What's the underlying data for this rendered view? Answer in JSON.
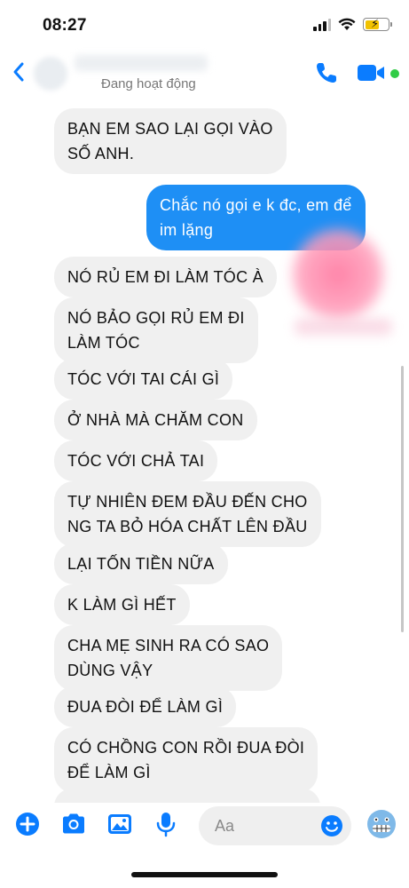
{
  "status_bar": {
    "time": "08:27"
  },
  "header": {
    "active_status": "Đang hoạt động",
    "icons": [
      "back-icon",
      "phone-icon",
      "video-icon"
    ]
  },
  "messages": [
    {
      "side": "incoming",
      "text": "BẠN EM SAO LẠI GỌI VÀO\nSỐ ANH."
    },
    {
      "side": "outgoing",
      "text": "Chắc nó gọi e k đc, em để\nim lặng"
    },
    {
      "side": "incoming",
      "text": "NÓ RỦ EM ĐI LÀM TÓC À"
    },
    {
      "side": "incoming",
      "text": "NÓ BẢO GỌI RỦ EM ĐI\nLÀM TÓC"
    },
    {
      "side": "incoming",
      "text": "TÓC VỚI TAI CÁI GÌ"
    },
    {
      "side": "incoming",
      "text": "Ở NHÀ MÀ CHĂM CON"
    },
    {
      "side": "incoming",
      "text": "TÓC VỚI CHẢ TAI"
    },
    {
      "side": "incoming",
      "text": "TỰ NHIÊN ĐEM ĐẦU ĐẾN CHO\nNG TA BỎ HÓA CHẤT LÊN ĐẦU"
    },
    {
      "side": "incoming",
      "text": "LẠI TỐN TIỀN NỮA"
    },
    {
      "side": "incoming",
      "text": "K LÀM GÌ HẾT"
    },
    {
      "side": "incoming",
      "text": "CHA MẸ SINH RA CÓ SAO\nDÙNG VẬY"
    },
    {
      "side": "incoming",
      "text": "ĐUA ĐÒI ĐỂ LÀM GÌ"
    },
    {
      "side": "incoming",
      "text": "CÓ CHỒNG CON RỒI ĐUA ĐÒI\nĐỂ LÀM GÌ"
    }
  ],
  "composer": {
    "placeholder": "Aa",
    "icons": [
      "plus-icon",
      "camera-icon",
      "gallery-icon",
      "microphone-icon",
      "emoji-icon",
      "sticker-emoji-icon"
    ]
  },
  "colors": {
    "accent": "#0a7cff",
    "outgoing_bubble": "#1e8ff5",
    "incoming_bubble": "#f0f0f0",
    "online": "#31cc46"
  }
}
